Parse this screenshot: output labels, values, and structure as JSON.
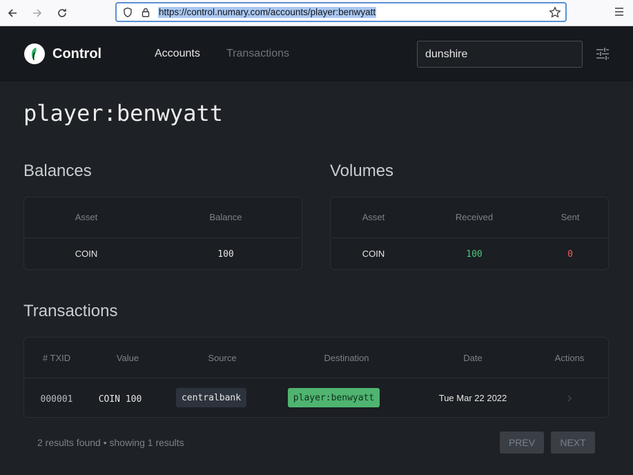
{
  "browser": {
    "url": "https://control.numary.com/accounts/player:benwyatt"
  },
  "header": {
    "logo_text": "Control",
    "nav": {
      "accounts": "Accounts",
      "transactions": "Transactions"
    },
    "search_value": "dunshire"
  },
  "page": {
    "title": "player:benwyatt"
  },
  "balances": {
    "title": "Balances",
    "headers": [
      "Asset",
      "Balance"
    ],
    "rows": [
      {
        "asset": "COIN",
        "balance": "100"
      }
    ]
  },
  "volumes": {
    "title": "Volumes",
    "headers": [
      "Asset",
      "Received",
      "Sent"
    ],
    "rows": [
      {
        "asset": "COIN",
        "received": "100",
        "sent": "0"
      }
    ]
  },
  "transactions": {
    "title": "Transactions",
    "headers": [
      "# TXID",
      "Value",
      "Source",
      "Destination",
      "Date",
      "Actions"
    ],
    "rows": [
      {
        "txid": "000001",
        "value": "COIN 100",
        "source": "centralbank",
        "destination": "player:benwyatt",
        "date": "Tue Mar 22 2022"
      }
    ],
    "footer": "2 results found • showing 1 results",
    "prev": "PREV",
    "next": "NEXT"
  },
  "colors": {
    "accent_green": "#4fb470",
    "sent_red": "#ef5e5e",
    "background": "#1e2125"
  }
}
